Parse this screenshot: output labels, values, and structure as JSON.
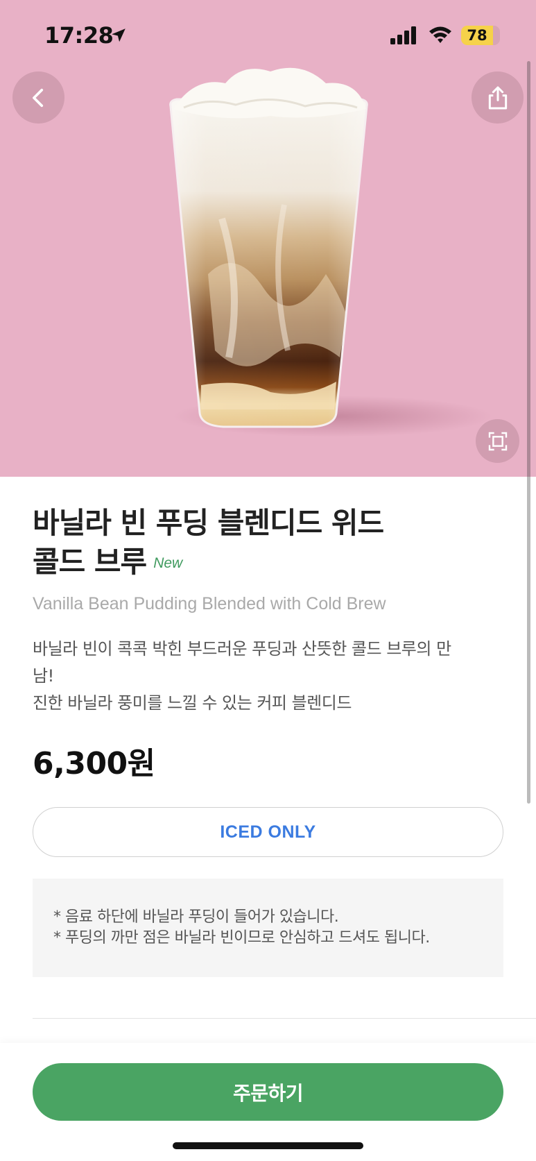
{
  "status_bar": {
    "time": "17:28",
    "battery": "78",
    "icons": [
      "location-arrow-icon",
      "cellular-signal-icon",
      "wifi-icon",
      "battery-icon"
    ]
  },
  "header": {
    "icons": [
      "back-chevron-icon",
      "share-icon",
      "expand-icon"
    ]
  },
  "product": {
    "title_line1": "바닐라 빈 푸딩 블렌디드 위드",
    "title_line2": "콜드 브루",
    "badge": "New",
    "english_name": "Vanilla Bean Pudding Blended with Cold Brew",
    "description_line1": "바닐라 빈이 콕콕 박힌 부드러운 푸딩과 산뜻한 콜드 브루의 만",
    "description_line2": "남!",
    "description_line3": "진한 바닐라 풍미를 느낄 수 있는 커피 블렌디드",
    "price": "6,300원",
    "temperature": "ICED ONLY",
    "notice_line1": "* 음료 하단에 바닐라 푸딩이 들어가 있습니다.",
    "notice_line2": "* 푸딩의 까만 점은 바닐라 빈이므로 안심하고 드셔도 됩니다."
  },
  "actions": {
    "order_label": "주문하기"
  },
  "colors": {
    "hero_background": "#e8b1c6",
    "accent_green": "#4aa463",
    "badge_green": "#3f9a5e",
    "iced_blue": "#3b7be0",
    "battery_yellow": "#f6d24a"
  }
}
